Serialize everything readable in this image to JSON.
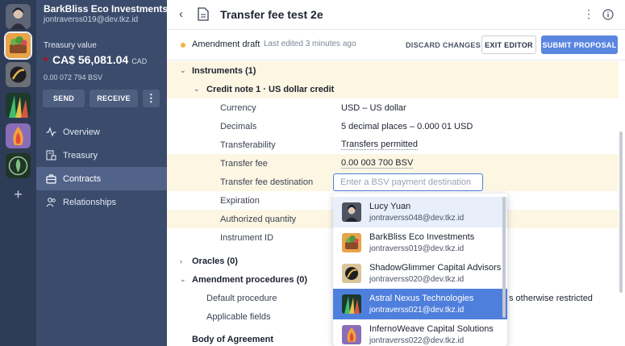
{
  "org": {
    "name": "BarkBliss Eco Investments",
    "email": "jontraverss019@dev.tkz.id"
  },
  "treasury": {
    "label": "Treasury value",
    "amount": "CA$ 56,081.04",
    "currency": "CAD",
    "bsv": "0.00 072 794 BSV",
    "send": "SEND",
    "receive": "RECEIVE"
  },
  "nav": [
    {
      "label": "Overview",
      "icon": "activity-icon"
    },
    {
      "label": "Treasury",
      "icon": "treasury-icon"
    },
    {
      "label": "Contracts",
      "icon": "briefcase-icon",
      "active": true
    },
    {
      "label": "Relationships",
      "icon": "people-icon"
    }
  ],
  "header": {
    "title": "Transfer fee test 2e"
  },
  "draft": {
    "status": "Amendment draft",
    "last_edited": "Last edited 3 minutes ago",
    "discard": "DISCARD CHANGES",
    "exit": "EXIT EDITOR",
    "submit": "SUBMIT PROPOSAL"
  },
  "instruments": {
    "section": "Instruments (1)",
    "credit_note": "Credit note 1 · US dollar credit",
    "fields": {
      "currency_label": "Currency",
      "currency_value": "USD – US dollar",
      "decimals_label": "Decimals",
      "decimals_value": "5 decimal places – 0.000 01 USD",
      "transferability_label": "Transferability",
      "transferability_value": "Transfers permitted",
      "fee_label": "Transfer fee",
      "fee_value": "0.00 003 700 BSV",
      "dest_label": "Transfer fee destination",
      "dest_placeholder": "Enter a BSV payment destination",
      "expiration_label": "Expiration",
      "authorized_label": "Authorized quantity",
      "instrument_id_label": "Instrument ID"
    }
  },
  "oracles": {
    "section": "Oracles (0)"
  },
  "amendment": {
    "section": "Amendment procedures (0)",
    "default_label": "Default procedure",
    "default_value_tail": "s otherwise restricted",
    "applicable_label": "Applicable fields"
  },
  "body_agreement": {
    "section": "Body of Agreement"
  },
  "dropdown": [
    {
      "name": "Lucy Yuan",
      "email": "jontraverss048@dev.tkz.id"
    },
    {
      "name": "BarkBliss Eco Investments",
      "email": "jontraverss019@dev.tkz.id"
    },
    {
      "name": "ShadowGlimmer Capital Advisors",
      "email": "jontraverss020@dev.tkz.id"
    },
    {
      "name": "Astral Nexus Technologies",
      "email": "jontraverss021@dev.tkz.id",
      "selected": true
    },
    {
      "name": "InfernoWeave Capital Solutions",
      "email": "jontraverss022@dev.tkz.id"
    }
  ],
  "colors": {
    "rail": "#2f3c57",
    "sidebar": "#3b4b6b",
    "accent": "#5a86e0",
    "highlight_row": "#fdf6e3",
    "draft_dot": "#f2b33d"
  }
}
